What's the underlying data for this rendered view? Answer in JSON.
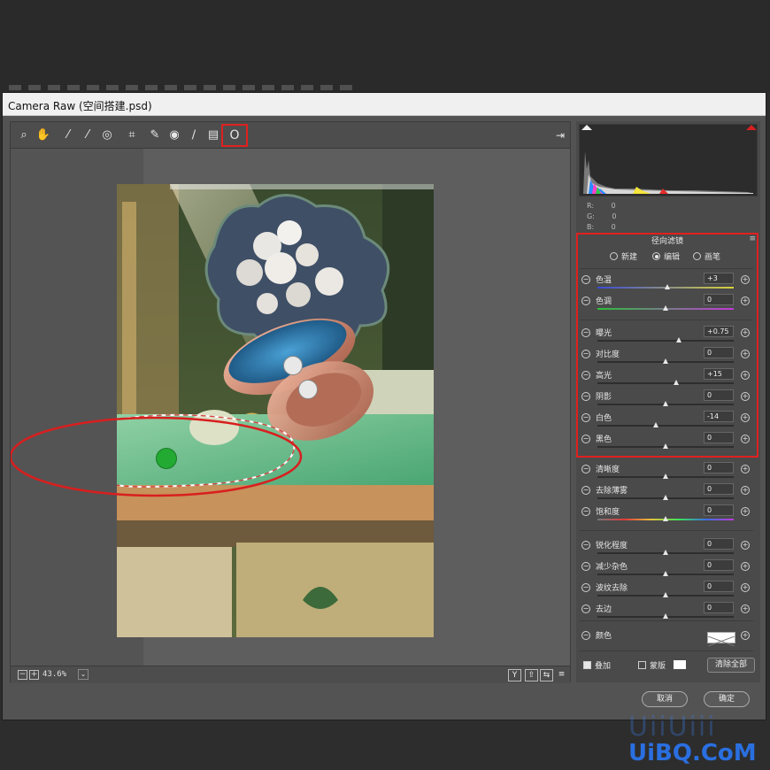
{
  "window": {
    "title": "Camera Raw (空间搭建.psd)"
  },
  "toolbar": {
    "tools": [
      {
        "name": "zoom-tool-icon",
        "glyph": "⌕"
      },
      {
        "name": "hand-tool-icon",
        "glyph": "✋"
      },
      {
        "name": "white-balance-tool-icon",
        "glyph": "⁄"
      },
      {
        "name": "color-sampler-tool-icon",
        "glyph": "⁄"
      },
      {
        "name": "targeted-adjustment-tool-icon",
        "glyph": "◎"
      },
      {
        "name": "crop-tool-icon",
        "glyph": "⌗"
      },
      {
        "name": "spot-removal-tool-icon",
        "glyph": "✎"
      },
      {
        "name": "red-eye-tool-icon",
        "glyph": "◉"
      },
      {
        "name": "adjustment-brush-icon",
        "glyph": "∕"
      },
      {
        "name": "graduated-filter-icon",
        "glyph": "▤"
      },
      {
        "name": "radial-filter-icon",
        "glyph": "O"
      }
    ]
  },
  "status": {
    "zoom": "43.6%",
    "zoom_minus": "−",
    "zoom_plus": "+",
    "zoom_dropdown": "⌄"
  },
  "view_buttons": {
    "y": "Y",
    "before": "⇧",
    "after": "⇆",
    "prefs": "≡"
  },
  "histogram": {
    "r_label": "R:",
    "g_label": "G:",
    "b_label": "B:",
    "r": "0",
    "g": "0",
    "b": "0"
  },
  "panel": {
    "title": "径向滤镜",
    "menu": "≡",
    "modes": [
      {
        "label": "新建",
        "selected": false
      },
      {
        "label": "编辑",
        "selected": true
      },
      {
        "label": "画笔",
        "selected": false
      }
    ],
    "sliders_group1": [
      {
        "label": "色温",
        "value": "+3",
        "pos": 0.51
      },
      {
        "label": "色调",
        "value": "0",
        "pos": 0.5
      }
    ],
    "sliders_group2": [
      {
        "label": "曝光",
        "value": "+0.75",
        "pos": 0.6
      },
      {
        "label": "对比度",
        "value": "0",
        "pos": 0.5
      },
      {
        "label": "高光",
        "value": "+15",
        "pos": 0.58
      },
      {
        "label": "阴影",
        "value": "0",
        "pos": 0.5
      },
      {
        "label": "白色",
        "value": "-14",
        "pos": 0.43
      },
      {
        "label": "黑色",
        "value": "0",
        "pos": 0.5
      }
    ],
    "sliders_group3": [
      {
        "label": "清晰度",
        "value": "0",
        "pos": 0.5
      },
      {
        "label": "去除薄雾",
        "value": "0",
        "pos": 0.5
      },
      {
        "label": "饱和度",
        "value": "0",
        "pos": 0.5
      }
    ],
    "sliders_group4": [
      {
        "label": "锐化程度",
        "value": "0",
        "pos": 0.5
      },
      {
        "label": "减少杂色",
        "value": "0",
        "pos": 0.5
      },
      {
        "label": "波纹去除",
        "value": "0",
        "pos": 0.5
      },
      {
        "label": "去边",
        "value": "0",
        "pos": 0.5
      }
    ],
    "color_label": "颜色",
    "overlay_label": "叠加",
    "mask_label": "蒙版",
    "clear_all": "清除全部",
    "overlay_checked": true,
    "mask_checked": false
  },
  "dialog_buttons": {
    "cancel": "取消",
    "ok": "确定"
  },
  "watermark": {
    "line1": "UiiUiii",
    "line2": "UiBQ.CoM"
  },
  "colors": {
    "highlight": "#e02020",
    "pin": "#22aa33"
  }
}
